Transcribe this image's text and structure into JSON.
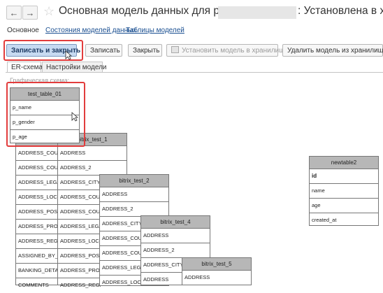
{
  "nav": {
    "back": "←",
    "forward": "→"
  },
  "title": {
    "text": "Основная модель данных для postgres",
    "suffix": ": Установлена в хр"
  },
  "sections": [
    {
      "label": "Основное",
      "link": false
    },
    {
      "label": "Состояния моделей данных",
      "link": true
    },
    {
      "label": "Таблицы моделей",
      "link": true
    }
  ],
  "toolbar": {
    "save_close": "Записать и закрыть",
    "save": "Записать",
    "close": "Закрыть",
    "install": "Установить модель в хранилище",
    "delete": "Удалить модель из хранилища"
  },
  "tabs": {
    "er": "ER-схема",
    "settings": "Настройки модели"
  },
  "scheme_label": "Графическая схема:",
  "tables": {
    "test_table_01": {
      "title": "test_table_01",
      "rows": [
        "p_name",
        "p_gender",
        "p_age"
      ]
    },
    "back_table": {
      "rows": [
        "ADDRESS_COUN",
        "ADDRESS_COUN",
        "ADDRESS_LEGA",
        "ADDRESS_LOC_",
        "ADDRESS_POST",
        "ADDRESS_PROV",
        "ADDRESS_REGI",
        "ASSIGNED_BY_I",
        "BANKING_DETAI",
        "COMMENTS"
      ]
    },
    "bitrix_test_1": {
      "title": "bitrix_test_1",
      "rows": [
        "ADDRESS",
        "ADDRESS_2",
        "ADDRESS_CITY",
        "ADDRESS_COUN",
        "ADDRESS_COUN",
        "ADDRESS_LEGA",
        "ADDRESS_LOC_",
        "ADDRESS_POST",
        "ADDRESS_PROV",
        "ADDRESS_REGI"
      ]
    },
    "bitrix_test_2": {
      "title": "bitrix_test_2",
      "rows": [
        "ADDRESS",
        "ADDRESS_2",
        "ADDRESS_CITY",
        "ADDRESS_COUN",
        "ADDRESS_COUN",
        "ADDRESS_LEGA",
        "ADDRESS_LOC_"
      ]
    },
    "bitrix_test_4": {
      "title": "bitrix_test_4",
      "rows": [
        "ADDRESS",
        "ADDRESS_2",
        "ADDRESS_CITY",
        "ADDRESS"
      ]
    },
    "bitrix_test_5": {
      "title": "bitrix_test_5",
      "rows": [
        "ADDRESS"
      ]
    },
    "newtable2": {
      "title": "newtable2",
      "rows": [
        "id",
        "name",
        "age",
        "created_at"
      ]
    }
  },
  "colors": {
    "highlight": "#e23c3c",
    "primary_button": "#c7daf1",
    "table_header": "#b7b7b7",
    "link": "#1a4f91"
  }
}
